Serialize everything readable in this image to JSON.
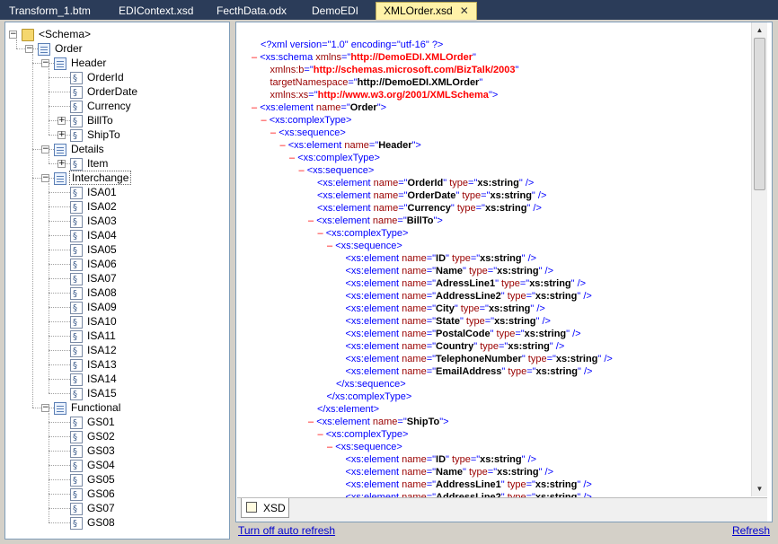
{
  "tabs": [
    {
      "label": "Transform_1.btm",
      "active": false
    },
    {
      "label": "EDIContext.xsd",
      "active": false
    },
    {
      "label": "FecthData.odx",
      "active": false
    },
    {
      "label": "DemoEDI",
      "active": false
    },
    {
      "label": "XMLOrder.xsd",
      "active": true
    }
  ],
  "tree": {
    "root": "<Schema>",
    "order": "Order",
    "header": "Header",
    "header_fields": [
      "OrderId",
      "OrderDate",
      "Currency",
      "BillTo",
      "ShipTo"
    ],
    "details": "Details",
    "item": "Item",
    "interchange": "Interchange",
    "isa_fields": [
      "ISA01",
      "ISA02",
      "ISA03",
      "ISA04",
      "ISA05",
      "ISA06",
      "ISA07",
      "ISA08",
      "ISA09",
      "ISA10",
      "ISA11",
      "ISA12",
      "ISA13",
      "ISA14",
      "ISA15"
    ],
    "functional": "Functional",
    "gs_fields": [
      "GS01",
      "GS02",
      "GS03",
      "GS04",
      "GS05",
      "GS06",
      "GS07",
      "GS08"
    ]
  },
  "xml_lines": [
    {
      "indent": 0,
      "collapse": false,
      "parts": [
        [
          "pi",
          "<?xml version=\"1.0\" encoding=\"utf-16\" ?>"
        ]
      ]
    },
    {
      "indent": 0,
      "collapse": true,
      "parts": [
        [
          "t",
          "<xs:schema "
        ],
        [
          "an",
          "xmlns"
        ],
        [
          "t",
          "=\""
        ],
        [
          "avr",
          "http://DemoEDI.XMLOrder"
        ],
        [
          "t",
          "\""
        ]
      ]
    },
    {
      "indent": 1,
      "collapse": false,
      "parts": [
        [
          "an",
          "xmlns:b"
        ],
        [
          "t",
          "=\""
        ],
        [
          "avr",
          "http://schemas.microsoft.com/BizTalk/2003"
        ],
        [
          "t",
          "\""
        ]
      ]
    },
    {
      "indent": 1,
      "collapse": false,
      "parts": [
        [
          "an",
          "targetNamespace"
        ],
        [
          "t",
          "=\""
        ],
        [
          "av",
          "http://DemoEDI.XMLOrder"
        ],
        [
          "t",
          "\""
        ]
      ]
    },
    {
      "indent": 1,
      "collapse": false,
      "parts": [
        [
          "an",
          "xmlns:xs"
        ],
        [
          "t",
          "=\""
        ],
        [
          "avr",
          "http://www.w3.org/2001/XMLSchema"
        ],
        [
          "t",
          "\">"
        ]
      ]
    },
    {
      "indent": 0,
      "collapse": true,
      "parts": [
        [
          "t",
          "<xs:element "
        ],
        [
          "an",
          "name"
        ],
        [
          "t",
          "=\""
        ],
        [
          "av",
          "Order"
        ],
        [
          "t",
          "\">"
        ]
      ]
    },
    {
      "indent": 1,
      "collapse": true,
      "parts": [
        [
          "t",
          "<xs:complexType>"
        ]
      ]
    },
    {
      "indent": 2,
      "collapse": true,
      "parts": [
        [
          "t",
          "<xs:sequence>"
        ]
      ]
    },
    {
      "indent": 3,
      "collapse": true,
      "parts": [
        [
          "t",
          "<xs:element "
        ],
        [
          "an",
          "name"
        ],
        [
          "t",
          "=\""
        ],
        [
          "av",
          "Header"
        ],
        [
          "t",
          "\">"
        ]
      ]
    },
    {
      "indent": 4,
      "collapse": true,
      "parts": [
        [
          "t",
          "<xs:complexType>"
        ]
      ]
    },
    {
      "indent": 5,
      "collapse": true,
      "parts": [
        [
          "t",
          "<xs:sequence>"
        ]
      ]
    },
    {
      "indent": 6,
      "collapse": false,
      "parts": [
        [
          "t",
          "<xs:element "
        ],
        [
          "an",
          "name"
        ],
        [
          "t",
          "=\""
        ],
        [
          "av",
          "OrderId"
        ],
        [
          "t",
          "\" "
        ],
        [
          "an",
          "type"
        ],
        [
          "t",
          "=\""
        ],
        [
          "av",
          "xs:string"
        ],
        [
          "t",
          "\" />"
        ]
      ]
    },
    {
      "indent": 6,
      "collapse": false,
      "parts": [
        [
          "t",
          "<xs:element "
        ],
        [
          "an",
          "name"
        ],
        [
          "t",
          "=\""
        ],
        [
          "av",
          "OrderDate"
        ],
        [
          "t",
          "\" "
        ],
        [
          "an",
          "type"
        ],
        [
          "t",
          "=\""
        ],
        [
          "av",
          "xs:string"
        ],
        [
          "t",
          "\" />"
        ]
      ]
    },
    {
      "indent": 6,
      "collapse": false,
      "parts": [
        [
          "t",
          "<xs:element "
        ],
        [
          "an",
          "name"
        ],
        [
          "t",
          "=\""
        ],
        [
          "av",
          "Currency"
        ],
        [
          "t",
          "\" "
        ],
        [
          "an",
          "type"
        ],
        [
          "t",
          "=\""
        ],
        [
          "av",
          "xs:string"
        ],
        [
          "t",
          "\" />"
        ]
      ]
    },
    {
      "indent": 6,
      "collapse": true,
      "parts": [
        [
          "t",
          "<xs:element "
        ],
        [
          "an",
          "name"
        ],
        [
          "t",
          "=\""
        ],
        [
          "av",
          "BillTo"
        ],
        [
          "t",
          "\">"
        ]
      ]
    },
    {
      "indent": 7,
      "collapse": true,
      "parts": [
        [
          "t",
          "<xs:complexType>"
        ]
      ]
    },
    {
      "indent": 8,
      "collapse": true,
      "parts": [
        [
          "t",
          "<xs:sequence>"
        ]
      ]
    },
    {
      "indent": 9,
      "collapse": false,
      "parts": [
        [
          "t",
          "<xs:element "
        ],
        [
          "an",
          "name"
        ],
        [
          "t",
          "=\""
        ],
        [
          "av",
          "ID"
        ],
        [
          "t",
          "\" "
        ],
        [
          "an",
          "type"
        ],
        [
          "t",
          "=\""
        ],
        [
          "av",
          "xs:string"
        ],
        [
          "t",
          "\" />"
        ]
      ]
    },
    {
      "indent": 9,
      "collapse": false,
      "parts": [
        [
          "t",
          "<xs:element "
        ],
        [
          "an",
          "name"
        ],
        [
          "t",
          "=\""
        ],
        [
          "av",
          "Name"
        ],
        [
          "t",
          "\" "
        ],
        [
          "an",
          "type"
        ],
        [
          "t",
          "=\""
        ],
        [
          "av",
          "xs:string"
        ],
        [
          "t",
          "\" />"
        ]
      ]
    },
    {
      "indent": 9,
      "collapse": false,
      "parts": [
        [
          "t",
          "<xs:element "
        ],
        [
          "an",
          "name"
        ],
        [
          "t",
          "=\""
        ],
        [
          "av",
          "AdressLine1"
        ],
        [
          "t",
          "\" "
        ],
        [
          "an",
          "type"
        ],
        [
          "t",
          "=\""
        ],
        [
          "av",
          "xs:string"
        ],
        [
          "t",
          "\" />"
        ]
      ]
    },
    {
      "indent": 9,
      "collapse": false,
      "parts": [
        [
          "t",
          "<xs:element "
        ],
        [
          "an",
          "name"
        ],
        [
          "t",
          "=\""
        ],
        [
          "av",
          "AddressLine2"
        ],
        [
          "t",
          "\" "
        ],
        [
          "an",
          "type"
        ],
        [
          "t",
          "=\""
        ],
        [
          "av",
          "xs:string"
        ],
        [
          "t",
          "\" />"
        ]
      ]
    },
    {
      "indent": 9,
      "collapse": false,
      "parts": [
        [
          "t",
          "<xs:element "
        ],
        [
          "an",
          "name"
        ],
        [
          "t",
          "=\""
        ],
        [
          "av",
          "City"
        ],
        [
          "t",
          "\" "
        ],
        [
          "an",
          "type"
        ],
        [
          "t",
          "=\""
        ],
        [
          "av",
          "xs:string"
        ],
        [
          "t",
          "\" />"
        ]
      ]
    },
    {
      "indent": 9,
      "collapse": false,
      "parts": [
        [
          "t",
          "<xs:element "
        ],
        [
          "an",
          "name"
        ],
        [
          "t",
          "=\""
        ],
        [
          "av",
          "State"
        ],
        [
          "t",
          "\" "
        ],
        [
          "an",
          "type"
        ],
        [
          "t",
          "=\""
        ],
        [
          "av",
          "xs:string"
        ],
        [
          "t",
          "\" />"
        ]
      ]
    },
    {
      "indent": 9,
      "collapse": false,
      "parts": [
        [
          "t",
          "<xs:element "
        ],
        [
          "an",
          "name"
        ],
        [
          "t",
          "=\""
        ],
        [
          "av",
          "PostalCode"
        ],
        [
          "t",
          "\" "
        ],
        [
          "an",
          "type"
        ],
        [
          "t",
          "=\""
        ],
        [
          "av",
          "xs:string"
        ],
        [
          "t",
          "\" />"
        ]
      ]
    },
    {
      "indent": 9,
      "collapse": false,
      "parts": [
        [
          "t",
          "<xs:element "
        ],
        [
          "an",
          "name"
        ],
        [
          "t",
          "=\""
        ],
        [
          "av",
          "Country"
        ],
        [
          "t",
          "\" "
        ],
        [
          "an",
          "type"
        ],
        [
          "t",
          "=\""
        ],
        [
          "av",
          "xs:string"
        ],
        [
          "t",
          "\" />"
        ]
      ]
    },
    {
      "indent": 9,
      "collapse": false,
      "parts": [
        [
          "t",
          "<xs:element "
        ],
        [
          "an",
          "name"
        ],
        [
          "t",
          "=\""
        ],
        [
          "av",
          "TelephoneNumber"
        ],
        [
          "t",
          "\" "
        ],
        [
          "an",
          "type"
        ],
        [
          "t",
          "=\""
        ],
        [
          "av",
          "xs:string"
        ],
        [
          "t",
          "\" />"
        ]
      ]
    },
    {
      "indent": 9,
      "collapse": false,
      "parts": [
        [
          "t",
          "<xs:element "
        ],
        [
          "an",
          "name"
        ],
        [
          "t",
          "=\""
        ],
        [
          "av",
          "EmailAddress"
        ],
        [
          "t",
          "\" "
        ],
        [
          "an",
          "type"
        ],
        [
          "t",
          "=\""
        ],
        [
          "av",
          "xs:string"
        ],
        [
          "t",
          "\" />"
        ]
      ]
    },
    {
      "indent": 8,
      "collapse": false,
      "parts": [
        [
          "t",
          "</xs:sequence>"
        ]
      ]
    },
    {
      "indent": 7,
      "collapse": false,
      "parts": [
        [
          "t",
          "</xs:complexType>"
        ]
      ]
    },
    {
      "indent": 6,
      "collapse": false,
      "parts": [
        [
          "t",
          "</xs:element>"
        ]
      ]
    },
    {
      "indent": 6,
      "collapse": true,
      "parts": [
        [
          "t",
          "<xs:element "
        ],
        [
          "an",
          "name"
        ],
        [
          "t",
          "=\""
        ],
        [
          "av",
          "ShipTo"
        ],
        [
          "t",
          "\">"
        ]
      ]
    },
    {
      "indent": 7,
      "collapse": true,
      "parts": [
        [
          "t",
          "<xs:complexType>"
        ]
      ]
    },
    {
      "indent": 8,
      "collapse": true,
      "parts": [
        [
          "t",
          "<xs:sequence>"
        ]
      ]
    },
    {
      "indent": 9,
      "collapse": false,
      "parts": [
        [
          "t",
          "<xs:element "
        ],
        [
          "an",
          "name"
        ],
        [
          "t",
          "=\""
        ],
        [
          "av",
          "ID"
        ],
        [
          "t",
          "\" "
        ],
        [
          "an",
          "type"
        ],
        [
          "t",
          "=\""
        ],
        [
          "av",
          "xs:string"
        ],
        [
          "t",
          "\" />"
        ]
      ]
    },
    {
      "indent": 9,
      "collapse": false,
      "parts": [
        [
          "t",
          "<xs:element "
        ],
        [
          "an",
          "name"
        ],
        [
          "t",
          "=\""
        ],
        [
          "av",
          "Name"
        ],
        [
          "t",
          "\" "
        ],
        [
          "an",
          "type"
        ],
        [
          "t",
          "=\""
        ],
        [
          "av",
          "xs:string"
        ],
        [
          "t",
          "\" />"
        ]
      ]
    },
    {
      "indent": 9,
      "collapse": false,
      "parts": [
        [
          "t",
          "<xs:element "
        ],
        [
          "an",
          "name"
        ],
        [
          "t",
          "=\""
        ],
        [
          "av",
          "AddressLine1"
        ],
        [
          "t",
          "\" "
        ],
        [
          "an",
          "type"
        ],
        [
          "t",
          "=\""
        ],
        [
          "av",
          "xs:string"
        ],
        [
          "t",
          "\" />"
        ]
      ]
    },
    {
      "indent": 9,
      "collapse": false,
      "parts": [
        [
          "t",
          "<xs:element "
        ],
        [
          "an",
          "name"
        ],
        [
          "t",
          "=\""
        ],
        [
          "av",
          "AddressLine2"
        ],
        [
          "t",
          "\" "
        ],
        [
          "an",
          "type"
        ],
        [
          "t",
          "=\""
        ],
        [
          "av",
          "xs:string"
        ],
        [
          "t",
          "\" />"
        ]
      ]
    }
  ],
  "bottom_tab": "XSD",
  "links": {
    "auto_refresh": "Turn off auto refresh",
    "refresh": "Refresh"
  }
}
